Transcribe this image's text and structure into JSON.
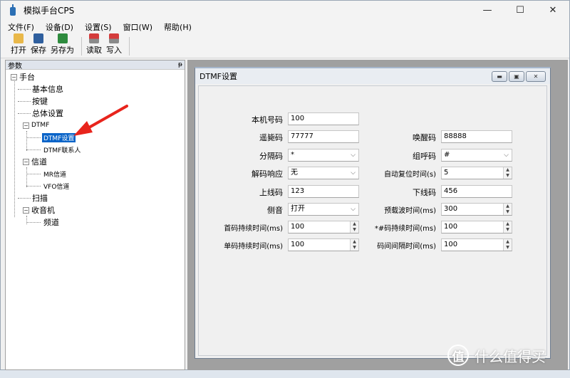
{
  "window": {
    "title": "模拟手台CPS",
    "controls": [
      "—",
      "☐",
      "✕"
    ]
  },
  "menu": {
    "items": [
      "文件(F)",
      "设备(D)",
      "设置(S)",
      "窗口(W)",
      "帮助(H)"
    ]
  },
  "toolbar": {
    "buttons": [
      "打开",
      "保存",
      "另存为",
      "读取",
      "写入"
    ]
  },
  "left_panel": {
    "title": "参数",
    "pin": "ᵽ",
    "tree": {
      "root": "手台",
      "basic": "基本信息",
      "keys": "按键",
      "general": "总体设置",
      "dtmf": "DTMF",
      "dtmf_setting": "DTMF设置",
      "dtmf_contacts": "DTMF联系人",
      "channel": "信道",
      "mr_channel": "MR信道",
      "vfo_channel": "VFO信道",
      "scan": "扫描",
      "radio": "收音机",
      "frequency": "频道"
    }
  },
  "dtmf_window": {
    "title": "DTMF设置",
    "fields": {
      "local_code": {
        "label": "本机号码",
        "value": "100"
      },
      "remote_kill": {
        "label": "遥毙码",
        "value": "77777"
      },
      "wake_code": {
        "label": "唤醒码",
        "value": "88888"
      },
      "separator": {
        "label": "分隔码",
        "value": "*"
      },
      "group_code": {
        "label": "组呼码",
        "value": "#"
      },
      "decode_response": {
        "label": "解码响应",
        "value": "无"
      },
      "auto_reset": {
        "label": "自动复位时间(s)",
        "value": "5"
      },
      "up_code": {
        "label": "上线码",
        "value": "123"
      },
      "down_code": {
        "label": "下线码",
        "value": "456"
      },
      "sidetone": {
        "label": "侧音",
        "value": "打开"
      },
      "pre_carrier": {
        "label": "预载波时间(ms)",
        "value": "300"
      },
      "first_code": {
        "label": "首码持续时间(ms)",
        "value": "100"
      },
      "star_code": {
        "label": "*#码持续时间(ms)",
        "value": "100"
      },
      "single_code": {
        "label": "单码持续时间(ms)",
        "value": "100"
      },
      "code_interval": {
        "label": "码间间隔时间(ms)",
        "value": "100"
      }
    }
  },
  "watermark": {
    "text": "什么值得买",
    "icon": "值"
  },
  "colors": {
    "selection": "#0a64c8",
    "arrow": "#e8241c",
    "mdi_bg": "#a0a0a0"
  }
}
